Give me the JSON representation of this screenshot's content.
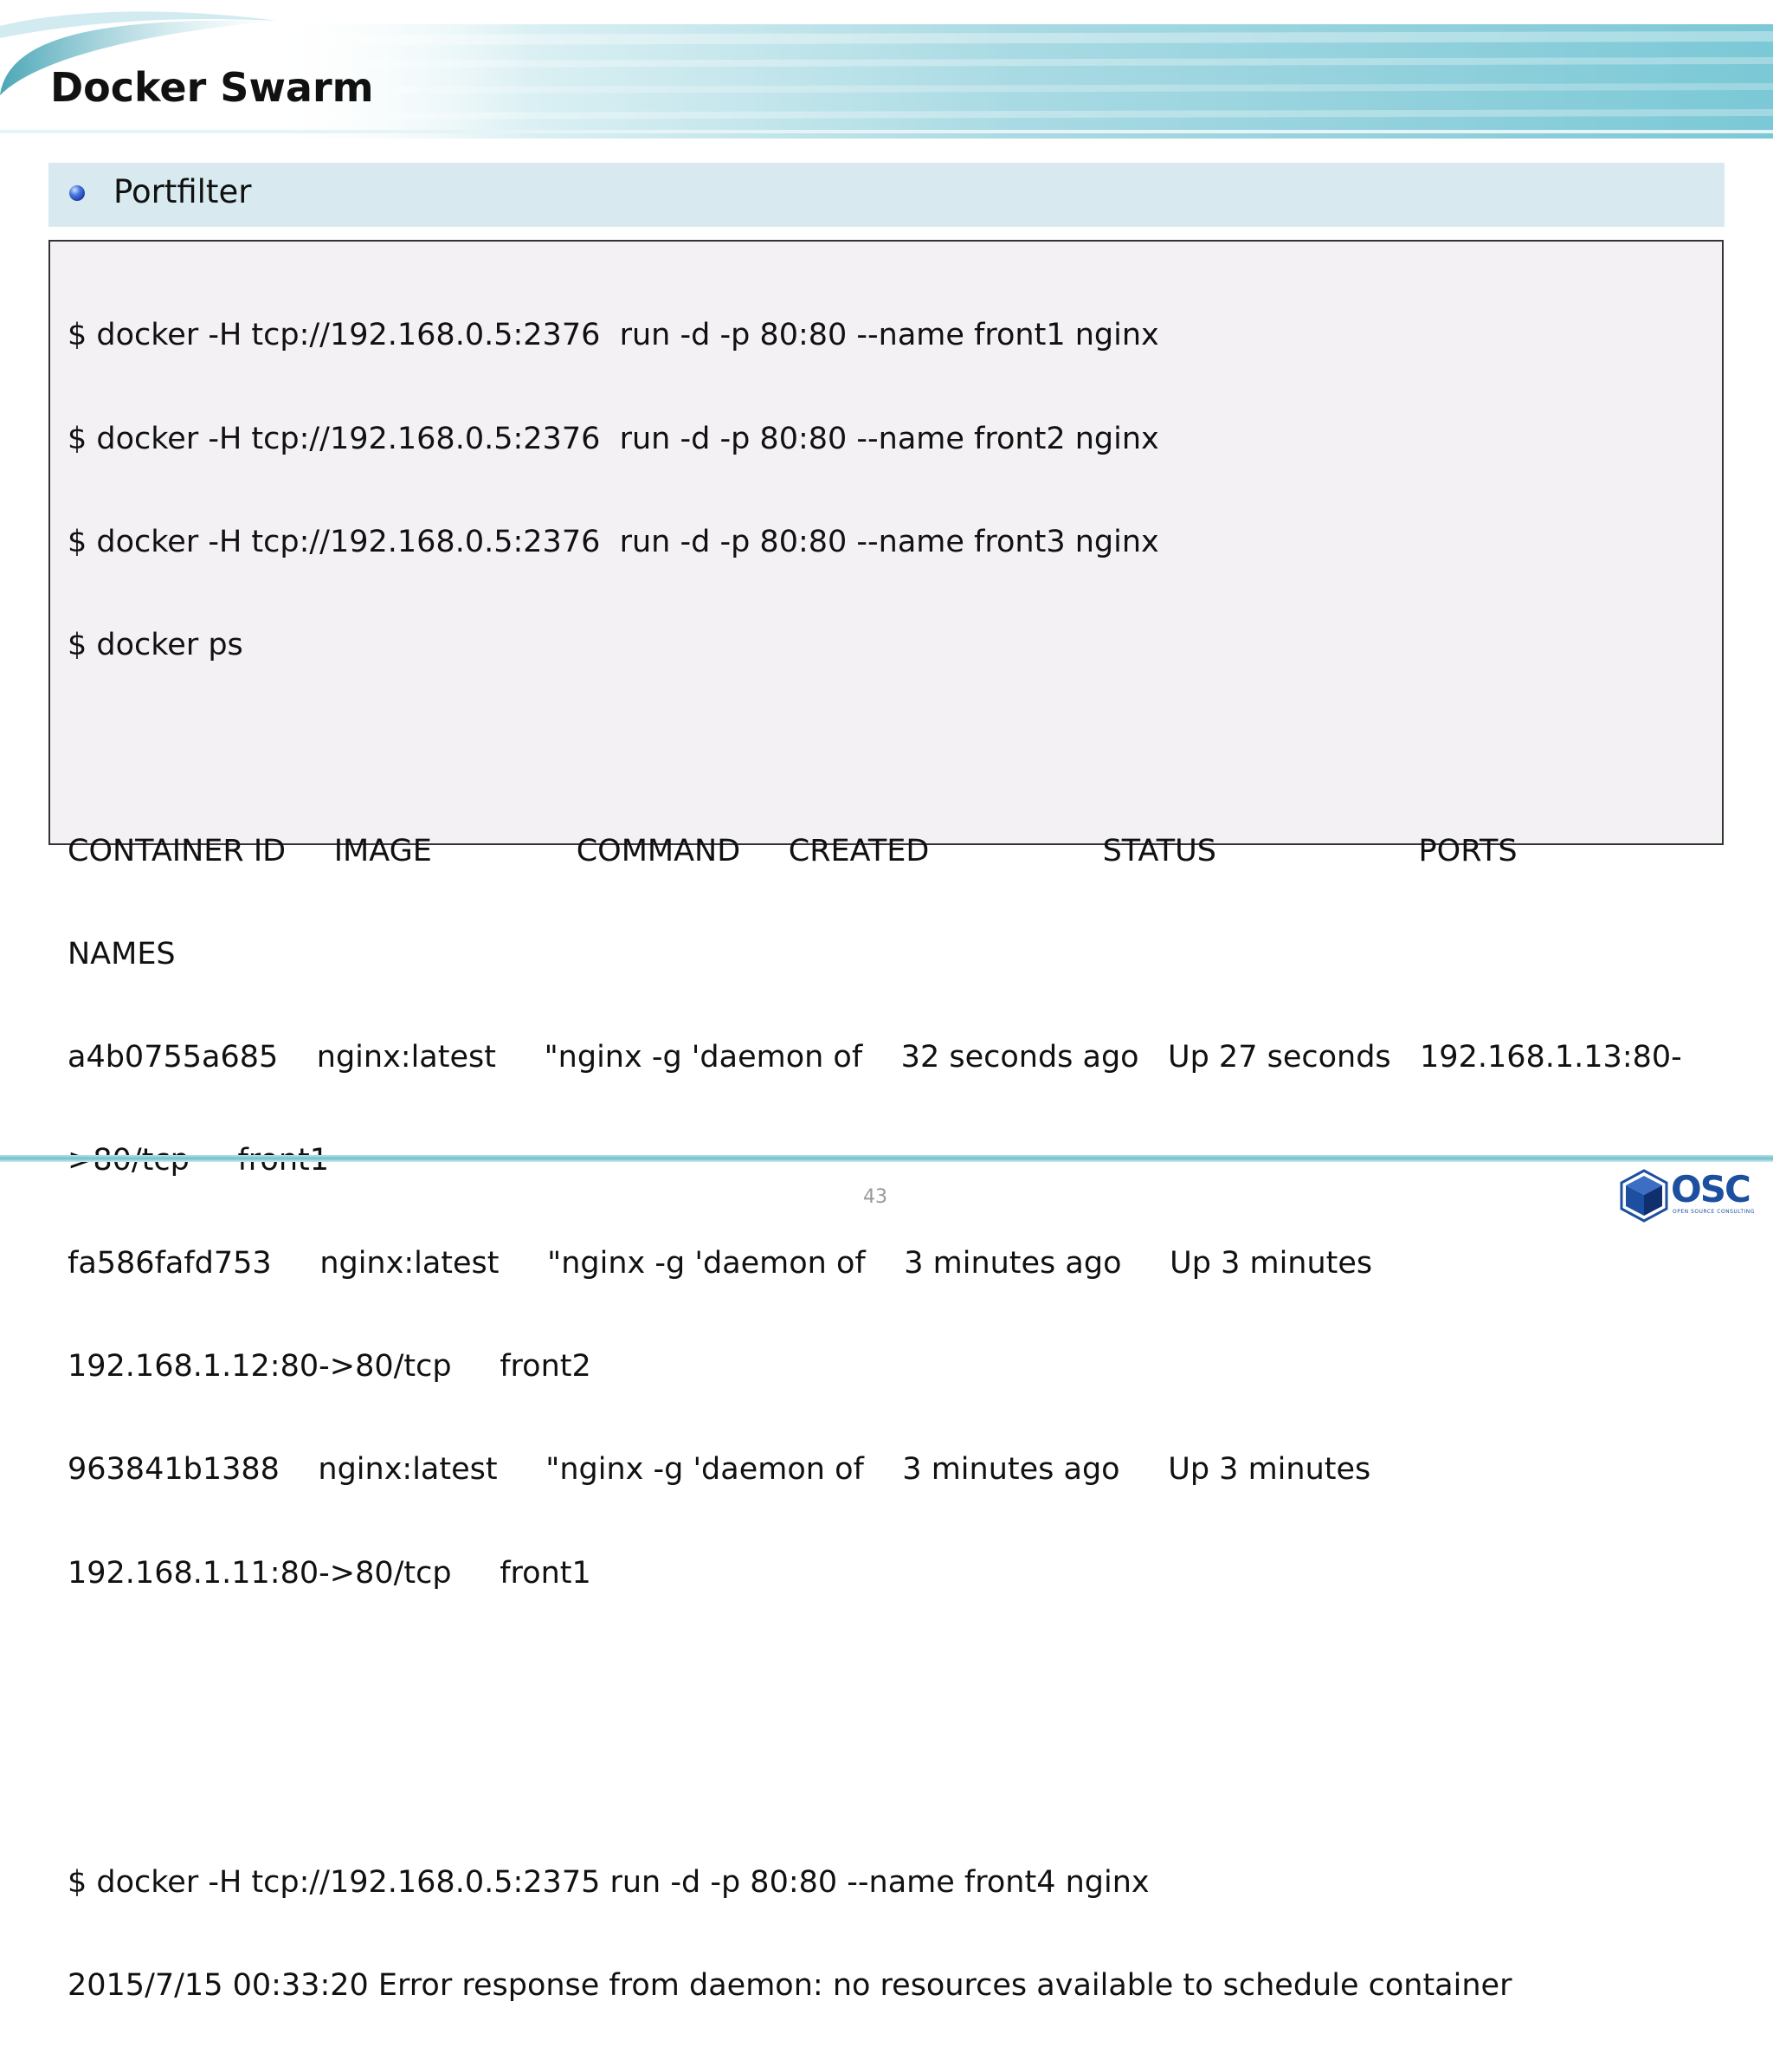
{
  "slide": {
    "title": "Docker Swarm",
    "bullet": "Portfilter",
    "page_number": "43"
  },
  "terminal": {
    "lines": [
      "$ docker -H tcp://192.168.0.5:2376  run -d -p 80:80 --name front1 nginx",
      "$ docker -H tcp://192.168.0.5:2376  run -d -p 80:80 --name front2 nginx",
      "$ docker -H tcp://192.168.0.5:2376  run -d -p 80:80 --name front3 nginx",
      "$ docker ps",
      "",
      "CONTAINER ID     IMAGE               COMMAND     CREATED                  STATUS                     PORTS",
      "NAMES",
      "a4b0755a685    nginx:latest     \"nginx -g 'daemon of    32 seconds ago   Up 27 seconds   192.168.1.13:80-",
      ">80/tcp     front1",
      "fa586fafd753     nginx:latest     \"nginx -g 'daemon of    3 minutes ago     Up 3 minutes",
      "192.168.1.12:80->80/tcp     front2",
      "963841b1388    nginx:latest     \"nginx -g 'daemon of    3 minutes ago     Up 3 minutes",
      "192.168.1.11:80->80/tcp     front1",
      "",
      "",
      "$ docker -H tcp://192.168.0.5:2375 run -d -p 80:80 --name front4 nginx",
      "2015/7/15 00:33:20 Error response from daemon: no resources available to schedule container"
    ]
  },
  "logo": {
    "name": "OSC",
    "tagline": "OPEN SOURCE CONSULTING"
  },
  "colors": {
    "header_teal": "#5fbccc",
    "bullet_bar": "#d8eaf0",
    "terminal_bg": "#f3f1f4",
    "logo_blue": "#1d4fa0"
  }
}
